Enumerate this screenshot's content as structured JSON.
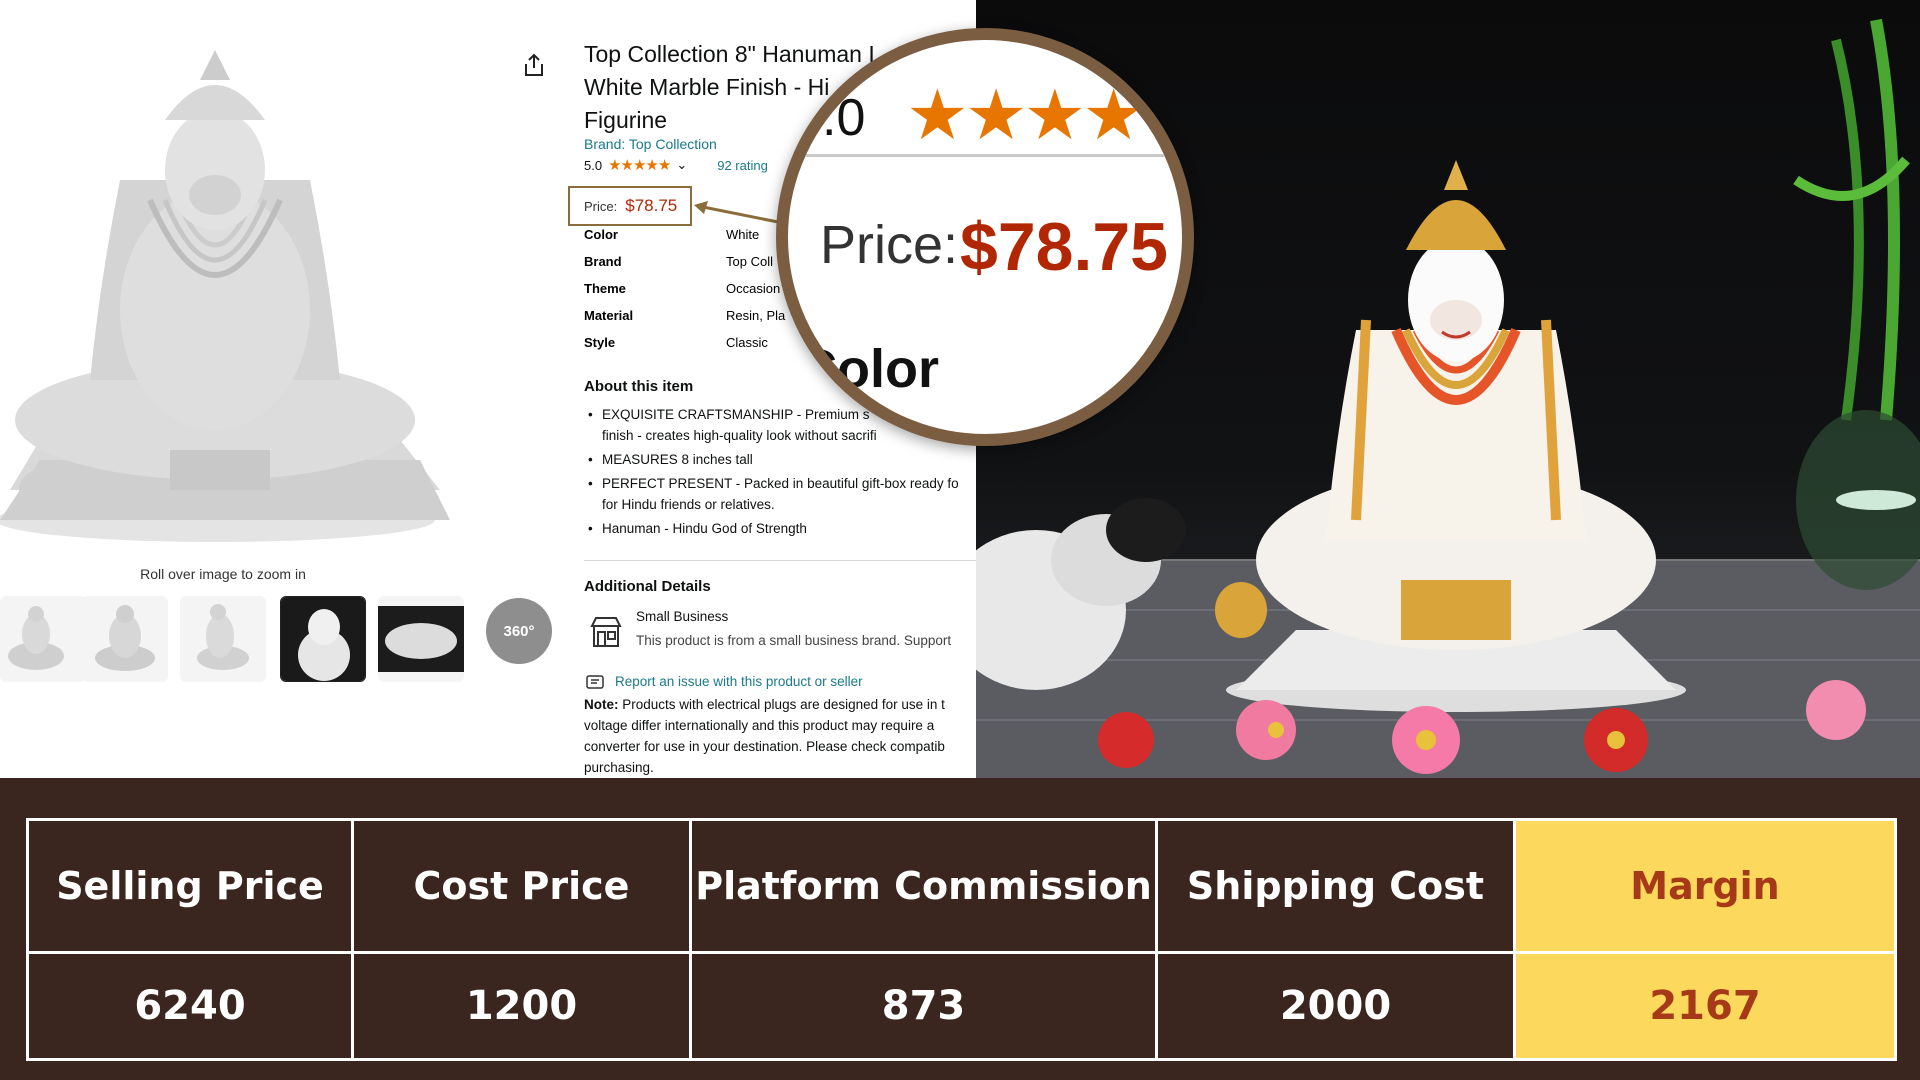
{
  "listing": {
    "title": "Top Collection 8\" Hanuman I... White Marble Finish - Hi... Figurine",
    "title_lines": [
      "Top Collection 8\" Hanuman I",
      "White Marble Finish - Hi",
      "Figurine"
    ],
    "brand": "Brand: Top Collection",
    "rating_value": "5.0",
    "rating_stars": "★★★★★",
    "rating_count": "92 rating",
    "price_label": "Price:",
    "price": "$78.75",
    "zoom_hint": "Roll over image to zoom in",
    "thumb_360_label": "360°",
    "specs": [
      {
        "key": "Color",
        "value": "White"
      },
      {
        "key": "Brand",
        "value": "Top Coll"
      },
      {
        "key": "Theme",
        "value": "Occasion"
      },
      {
        "key": "Material",
        "value": "Resin, Pla"
      },
      {
        "key": "Style",
        "value": "Classic"
      }
    ],
    "about_heading": "About this item",
    "bullets": [
      "EXQUISITE CRAFTSMANSHIP - Premium s\nfinish - creates high-quality look without sacrifi",
      "MEASURES 8 inches tall",
      "PERFECT PRESENT - Packed in beautiful gift-box ready fo\nfor Hindu friends or relatives.",
      "Hanuman - Hindu God of Strength"
    ],
    "additional_heading": "Additional Details",
    "small_business_title": "Small Business",
    "small_business_desc": "This product is from a small business brand. Support",
    "report_link": "Report an issue with this product or seller",
    "note_label": "Note:",
    "note_text": " Products with electrical plugs are designed for use in t voltage differ internationally and this product may require a converter for use in your destination. Please check compatib purchasing."
  },
  "magnifier": {
    "rating_fragment": ".0",
    "stars": "★★★★",
    "price_label": "Price:",
    "price": "$78.75",
    "color_label": "Color"
  },
  "table": {
    "headers": [
      "Selling Price",
      "Cost Price",
      "Platform Commission",
      "Shipping Cost",
      "Margin"
    ],
    "values": [
      "6240",
      "1200",
      "873",
      "2000",
      "2167"
    ],
    "highlight_color": "#fcd95c",
    "highlight_text_color": "#a63a18",
    "background_color": "#3a261e"
  }
}
